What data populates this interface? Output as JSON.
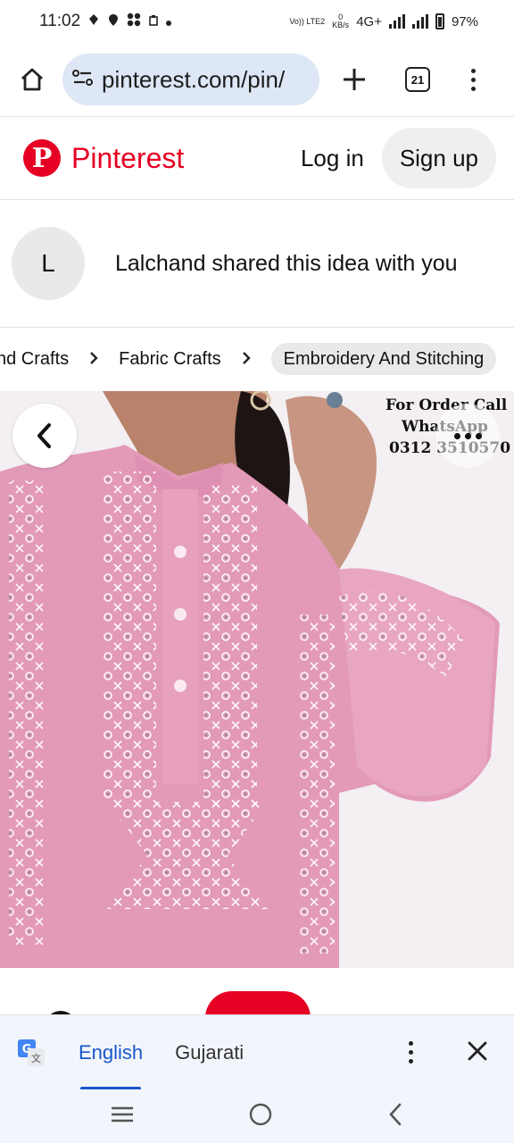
{
  "status_bar": {
    "time": "11:02",
    "network_small_top": "Vo)) LTE2",
    "data_speed_top": "0",
    "data_speed_unit": "KB/s",
    "network_type": "4G+",
    "battery": "97%"
  },
  "browser": {
    "url": "pinterest.com/pin/",
    "tab_count": "21"
  },
  "header": {
    "brand": "Pinterest",
    "login_label": "Log in",
    "signup_label": "Sign up"
  },
  "shared": {
    "avatar_initial": "L",
    "message": "Lalchand shared this idea with you"
  },
  "breadcrumbs": [
    "nd Crafts",
    "Fabric Crafts",
    "Embroidery And Stitching"
  ],
  "image_overlay": {
    "line1": "For Order Call",
    "line2": "WhatsApp",
    "line3": "0312 3510570"
  },
  "translate_bar": {
    "lang_active": "English",
    "lang_other": "Gujarati"
  },
  "colors": {
    "pinterest_red": "#e60023",
    "url_bar": "#dde7f6",
    "translate_blue": "#1a57c9",
    "garment_pink": "#e39ab8"
  }
}
